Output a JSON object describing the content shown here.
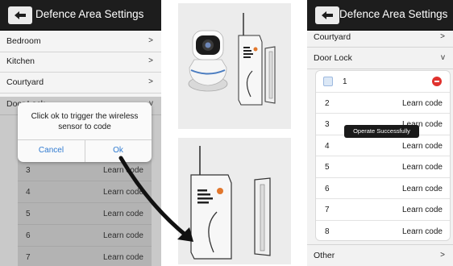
{
  "left_screen": {
    "header_title": "Defence Area Settings",
    "rows": [
      {
        "label": "Bedroom",
        "chevron": ">"
      },
      {
        "label": "Kitchen",
        "chevron": ">"
      },
      {
        "label": "Courtyard",
        "chevron": ">"
      },
      {
        "label": "Door Lock",
        "chevron": "v"
      }
    ],
    "sub_rows": [
      {
        "num": "3",
        "action": "Learn code"
      },
      {
        "num": "4",
        "action": "Learn code"
      },
      {
        "num": "5",
        "action": "Learn code"
      },
      {
        "num": "6",
        "action": "Learn code"
      },
      {
        "num": "7",
        "action": "Learn code"
      }
    ],
    "dialog": {
      "message": "Click ok to trigger the wireless sensor to code",
      "cancel_label": "Cancel",
      "ok_label": "Ok"
    }
  },
  "right_screen": {
    "header_title": "Defence Area Settings",
    "rows": [
      {
        "label": "Courtyard",
        "chevron": ">"
      },
      {
        "label": "Door Lock",
        "chevron": "v"
      }
    ],
    "zone_first": {
      "num": "1"
    },
    "zones": [
      {
        "num": "2",
        "action": "Learn code"
      },
      {
        "num": "3",
        "action": "Learn code"
      },
      {
        "num": "4",
        "action": "Learn code"
      },
      {
        "num": "5",
        "action": "Learn code"
      },
      {
        "num": "6",
        "action": "Learn code"
      },
      {
        "num": "7",
        "action": "Learn code"
      },
      {
        "num": "8",
        "action": "Learn code"
      }
    ],
    "toast": "Operate Successfully",
    "bottom_row": {
      "label": "Other",
      "chevron": ">"
    }
  },
  "icons": {
    "back": "back-arrow-icon",
    "delete": "delete-icon",
    "checkbox": "checkbox-icon"
  },
  "colors": {
    "header": "#1d1d1d",
    "dialog_button": "#2f7ad0",
    "delete": "#e0322e"
  }
}
